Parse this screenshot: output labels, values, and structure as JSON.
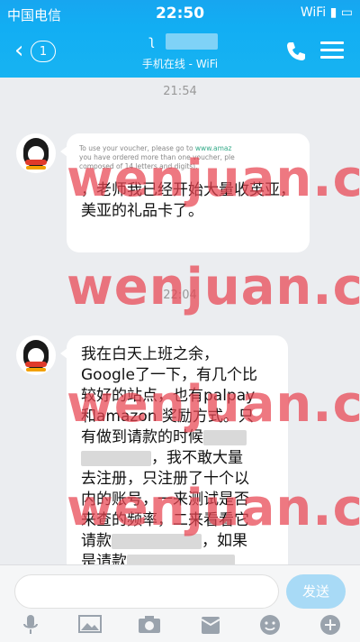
{
  "status_bar": {
    "carrier": "中国电信",
    "time": "22:50",
    "indicators": "WiFi ▮ ▭"
  },
  "header": {
    "unread_count": "1",
    "subtitle": "手机在线 - WiFi"
  },
  "chat": {
    "timestamps": [
      "21:54",
      "22:04"
    ],
    "messages": [
      {
        "quote_line1a": "To use your voucher, please go to ",
        "quote_link": "www.amaz",
        "quote_line2": "you have ordered more than one voucher, ple",
        "quote_line3": "composed of 14 letters and digits).",
        "text": "，老师我已经开始大量收英亚，美亚的礼品卡了。"
      },
      {
        "line1": "我在白天上班之余，",
        "line2": "Google了一下，有几个比",
        "line3": "较好的站点，也有palpay",
        "line4": "和amazon 奖励方式。只",
        "line5": "有做到请款的时候",
        "line6": "，我不敢大量",
        "line7": "去注册，只注册了十个以",
        "line8": "内的账号，一来测试是否",
        "line9": "来查的频率，二来看看它",
        "line10a": "请款",
        "line10b": "，如果",
        "line11": "是请款"
      }
    ]
  },
  "watermark": {
    "text": "wenjuan.cc",
    "color": "#e84450"
  },
  "input_bar": {
    "send_label": "发送"
  },
  "toolbar": {
    "icons": [
      "microphone-icon",
      "image-icon",
      "camera-icon",
      "red-packet-icon",
      "emoji-icon",
      "plus-icon"
    ]
  }
}
